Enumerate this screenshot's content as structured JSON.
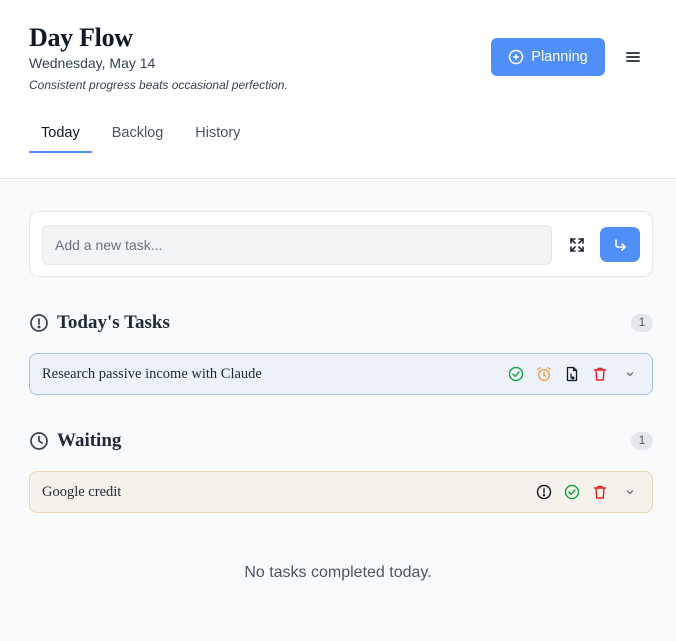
{
  "header": {
    "title": "Day Flow",
    "date": "Wednesday, May 14",
    "quote": "Consistent progress beats occasional perfection.",
    "planning_label": "Planning",
    "menu_icon": "hamburger-icon"
  },
  "tabs": [
    {
      "label": "Today",
      "active": true
    },
    {
      "label": "Backlog",
      "active": false
    },
    {
      "label": "History",
      "active": false
    }
  ],
  "add_task": {
    "placeholder": "Add a new task...",
    "expand_icon": "expand-icon",
    "submit_icon": "enter-arrow-icon"
  },
  "sections": {
    "today": {
      "title": "Today's Tasks",
      "icon": "alert-circle-icon",
      "count": "1",
      "tasks": [
        {
          "text": "Research passive income with Claude",
          "actions": [
            "check-circle-icon",
            "alarm-clock-icon",
            "file-move-icon",
            "trash-icon",
            "chevron-down-icon"
          ]
        }
      ]
    },
    "waiting": {
      "title": "Waiting",
      "icon": "clock-icon",
      "count": "1",
      "tasks": [
        {
          "text": "Google credit",
          "actions": [
            "alert-circle-icon",
            "check-circle-icon",
            "trash-icon",
            "chevron-down-icon"
          ]
        }
      ]
    }
  },
  "completed": {
    "empty_message": "No tasks completed today."
  },
  "colors": {
    "accent": "#4f8ff7",
    "success": "#22a34a",
    "warning": "#f59e42",
    "danger": "#dc2626",
    "today_row_bg": "#eef2fb",
    "waiting_row_bg": "#f5f2ec"
  }
}
